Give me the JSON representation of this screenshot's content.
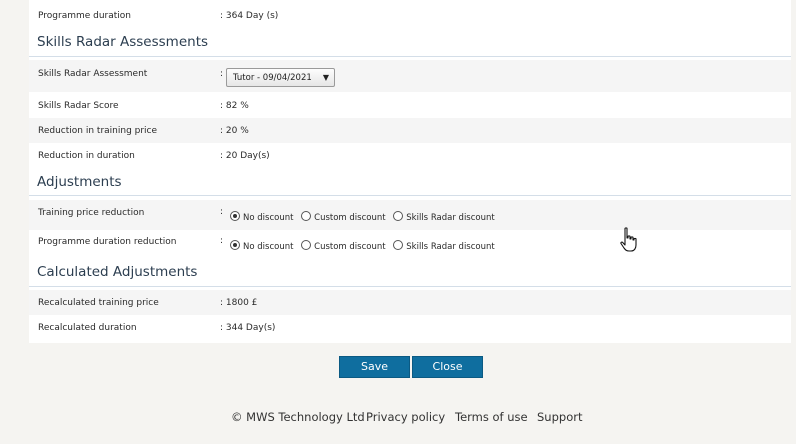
{
  "programme": {
    "duration_label": "Programme duration",
    "duration_value": ": 364 Day (s)"
  },
  "skills_radar": {
    "title": "Skills Radar Assessments",
    "assessment_label": "Skills Radar Assessment",
    "assessment_colon": ":",
    "assessment_selected": "Tutor - 09/04/2021",
    "score_label": "Skills Radar Score",
    "score_value": ": 82 %",
    "price_reduction_label": "Reduction in training price",
    "price_reduction_value": ": 20 %",
    "duration_reduction_label": "Reduction in duration",
    "duration_reduction_value": ": 20 Day(s)"
  },
  "adjustments": {
    "title": "Adjustments",
    "training_price_label": "Training price reduction",
    "programme_duration_label": "Programme duration reduction",
    "colon": ":",
    "options": [
      "No discount",
      "Custom discount",
      "Skills Radar discount"
    ],
    "training_price_selected": "No discount",
    "programme_duration_selected": "No discount"
  },
  "calculated": {
    "title": "Calculated Adjustments",
    "price_label": "Recalculated training price",
    "price_value": ": 1800 £",
    "duration_label": "Recalculated duration",
    "duration_value": ": 344 Day(s)"
  },
  "buttons": {
    "save": "Save",
    "close": "Close"
  },
  "footer": {
    "copyright": "© MWS Technology Ltd",
    "privacy": "Privacy policy",
    "terms": "Terms of use",
    "support": "Support"
  }
}
